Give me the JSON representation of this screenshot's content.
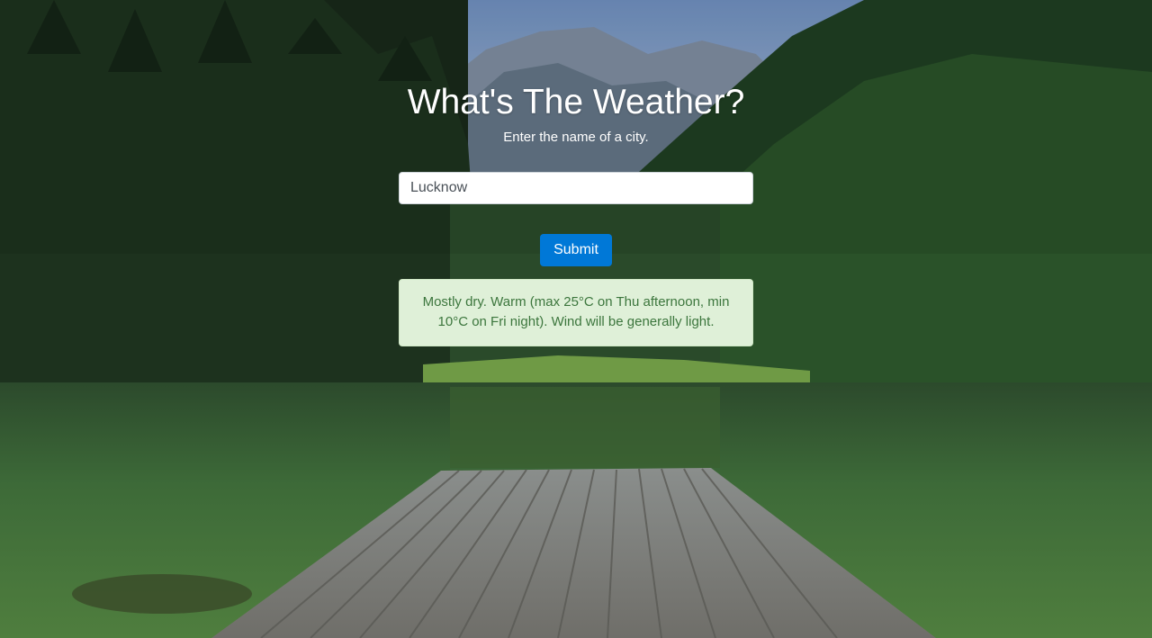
{
  "page": {
    "title": "What's The Weather?",
    "subtitle": "Enter the name of a city."
  },
  "search": {
    "value": "Lucknow",
    "placeholder": ""
  },
  "submit_label": "Submit",
  "result": {
    "text": "Mostly dry. Warm (max 25°C on Thu afternoon, min 10°C on Fri night). Wind will be generally light."
  },
  "colors": {
    "button": "#0078d7",
    "alert_bg": "#dff0d8",
    "alert_text": "#3c763d"
  }
}
